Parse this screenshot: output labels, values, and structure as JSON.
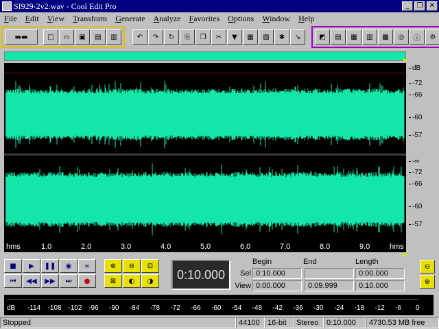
{
  "window": {
    "title": "SI929-2v2.wav - Cool Edit Pro",
    "min": "_",
    "max": "❐",
    "close": "✕"
  },
  "menu": [
    "File",
    "Edit",
    "View",
    "Transform",
    "Generate",
    "Analyze",
    "Favorites",
    "Options",
    "Window",
    "Help"
  ],
  "scale": {
    "unit": "dB",
    "top": [
      "-72",
      "-66",
      "-60",
      "-57"
    ],
    "bottom_inf": "-∞",
    "bottom": [
      "-72",
      "-66",
      "-60",
      "-57"
    ]
  },
  "timeline": {
    "start": "hms",
    "end": "hms",
    "ticks": [
      "1.0",
      "2.0",
      "3.0",
      "4.0",
      "5.0",
      "6.0",
      "7.0",
      "8.0",
      "9.0"
    ]
  },
  "time_display": "0:10.000",
  "selection": {
    "headers": {
      "begin": "Begin",
      "end": "End",
      "length": "Length"
    },
    "sel_label": "Sel",
    "view_label": "View",
    "sel_begin": "0:10.000",
    "sel_end": "",
    "sel_length": "0:00.000",
    "view_begin": "0:00.000",
    "view_end": "0:09.999",
    "view_length": "0:10.000"
  },
  "meter": {
    "labels": [
      "dB",
      "-114",
      "-108",
      "-102",
      "-96",
      "-90",
      "-84",
      "-78",
      "-72",
      "-66",
      "-60",
      "-54",
      "-48",
      "-42",
      "-36",
      "-30",
      "-24",
      "-18",
      "-12",
      "-6",
      "0"
    ]
  },
  "status": {
    "state": "Stopped",
    "rate": "44100",
    "bits": "16-bit",
    "channels": "Stereo",
    "length": "0:10.000",
    "free": "4730.53 MB free"
  },
  "colors": {
    "waveform": "#14e6a8",
    "background": "#000000",
    "accent": "#000080"
  }
}
